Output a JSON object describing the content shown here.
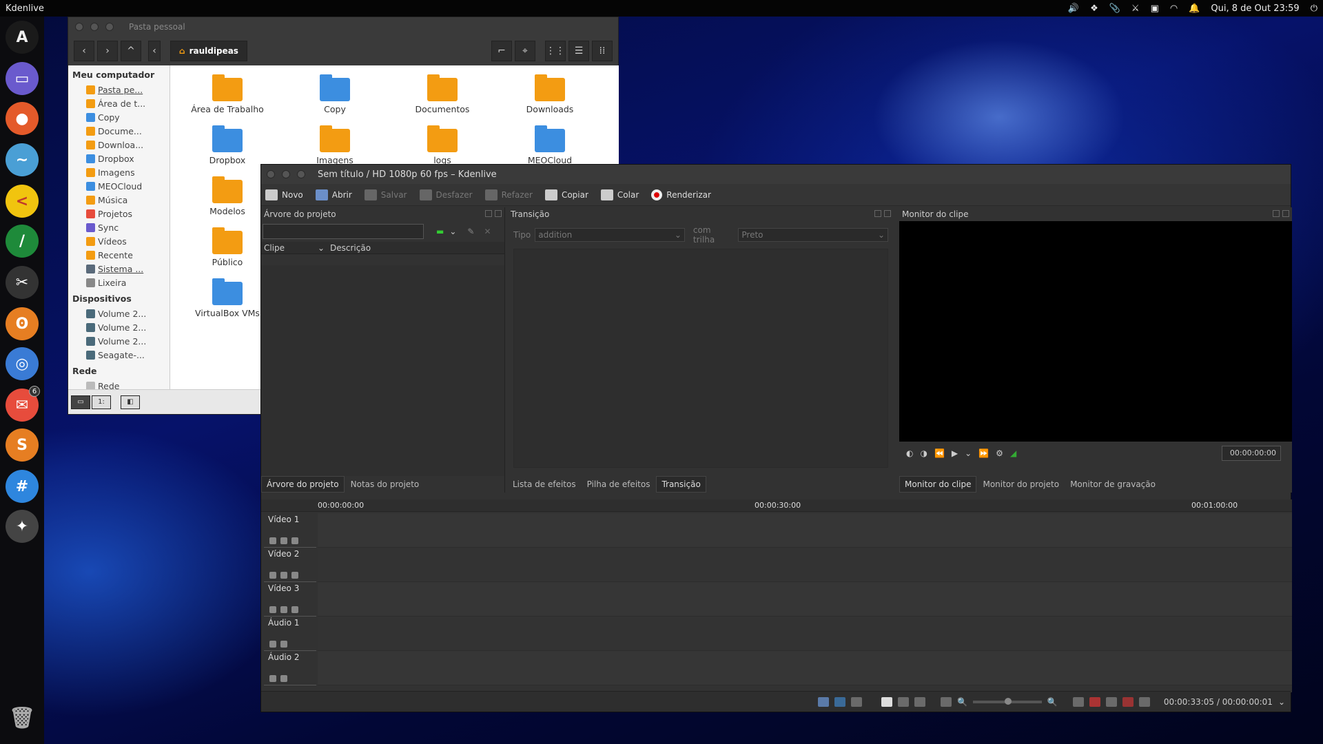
{
  "top_panel": {
    "app_name": "Kdenlive",
    "clock": "Qui, 8 de Out 23:59"
  },
  "dock": {
    "items": [
      {
        "icon": "arch-icon"
      },
      {
        "icon": "files-icon"
      },
      {
        "icon": "firefox-icon"
      },
      {
        "icon": "messenger-icon"
      },
      {
        "icon": "share-icon"
      },
      {
        "icon": "feather-icon"
      },
      {
        "icon": "scissors-icon"
      },
      {
        "icon": "gimp-icon"
      },
      {
        "icon": "blender-icon"
      },
      {
        "icon": "mail-icon",
        "badge": "6"
      },
      {
        "icon": "sublime-icon"
      },
      {
        "icon": "hashtag-icon"
      },
      {
        "icon": "kdenlive-icon"
      }
    ],
    "trash_icon": "trash-icon"
  },
  "file_manager": {
    "title": "Pasta pessoal",
    "path": "rauldipeas",
    "sidebar": {
      "sections": [
        {
          "label": "Meu computador",
          "items": [
            "Pasta pe...",
            "Área de t...",
            "Copy",
            "Docume...",
            "Downloa...",
            "Dropbox",
            "Imagens",
            "MEOCloud",
            "Música",
            "Projetos",
            "Sync",
            "Vídeos",
            "Recente",
            "Sistema ...",
            "Lixeira"
          ]
        },
        {
          "label": "Dispositivos",
          "items": [
            "Volume 2...",
            "Volume 2...",
            "Volume 2...",
            "Seagate-..."
          ]
        },
        {
          "label": "Rede",
          "items": [
            "Rede"
          ]
        }
      ]
    },
    "folders": [
      {
        "label": "Área de Trabalho",
        "color": "#f39c12"
      },
      {
        "label": "Copy",
        "color": "#3c8ee0"
      },
      {
        "label": "Documentos",
        "color": "#f39c12"
      },
      {
        "label": "Downloads",
        "color": "#f39c12"
      },
      {
        "label": "Dropbox",
        "color": "#3c8ee0"
      },
      {
        "label": "Imagens",
        "color": "#f39c12"
      },
      {
        "label": "logs",
        "color": "#f39c12"
      },
      {
        "label": "MEOCloud",
        "color": "#3c8ee0"
      },
      {
        "label": "Modelos",
        "color": "#f39c12"
      },
      {
        "label": "Público",
        "color": "#f39c12"
      },
      {
        "label": "VirtualBox VMs",
        "color": "#3c8ee0"
      }
    ]
  },
  "kdenlive": {
    "title": "Sem título / HD 1080p 60 fps – Kdenlive",
    "toolbar": {
      "new": "Novo",
      "open": "Abrir",
      "save": "Salvar",
      "undo": "Desfazer",
      "redo": "Refazer",
      "copy": "Copiar",
      "paste": "Colar",
      "render": "Renderizar"
    },
    "project_tree": {
      "title": "Árvore do projeto",
      "col_clip": "Clipe",
      "col_desc": "Descrição",
      "tabs": [
        "Árvore do projeto",
        "Notas do projeto"
      ]
    },
    "transition": {
      "title": "Transição",
      "type_label": "Tipo",
      "type_value": "addition",
      "track_label": "com trilha",
      "track_value": "Preto",
      "tabs": [
        "Lista de efeitos",
        "Pilha de efeitos",
        "Transição"
      ]
    },
    "monitor": {
      "title": "Monitor do clipe",
      "timecode": "00:00:00:00",
      "tabs": [
        "Monitor do clipe",
        "Monitor do projeto",
        "Monitor de gravação"
      ]
    },
    "timeline": {
      "marks": [
        "00:00:00:00",
        "00:00:30:00",
        "00:01:00:00"
      ],
      "tracks": [
        "Vídeo 1",
        "Vídeo 2",
        "Vídeo 3",
        "Áudio 1",
        "Áudio 2"
      ],
      "status_time": "00:00:33:05 / 00:00:00:01"
    }
  }
}
